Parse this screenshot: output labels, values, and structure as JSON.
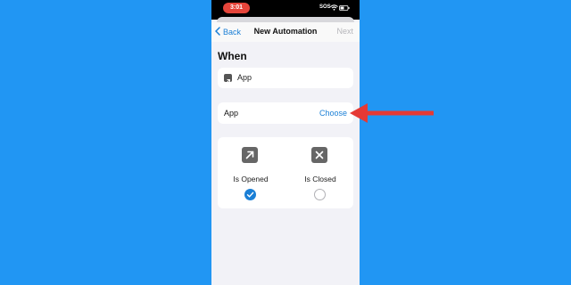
{
  "status_bar": {
    "time": "3:01",
    "carrier": "SOS"
  },
  "nav": {
    "back_label": "Back",
    "title": "New Automation",
    "next_label": "Next"
  },
  "section": {
    "title": "When"
  },
  "trigger": {
    "label": "App"
  },
  "app_row": {
    "label": "App",
    "action": "Choose"
  },
  "options": [
    {
      "label": "Is Opened",
      "icon": "arrow-up-right-icon",
      "checked": true
    },
    {
      "label": "Is Closed",
      "icon": "x-mark-icon",
      "checked": false
    }
  ],
  "colors": {
    "background": "#2196f3",
    "accent": "#1a7fd6",
    "annotation_arrow": "#e53935"
  }
}
